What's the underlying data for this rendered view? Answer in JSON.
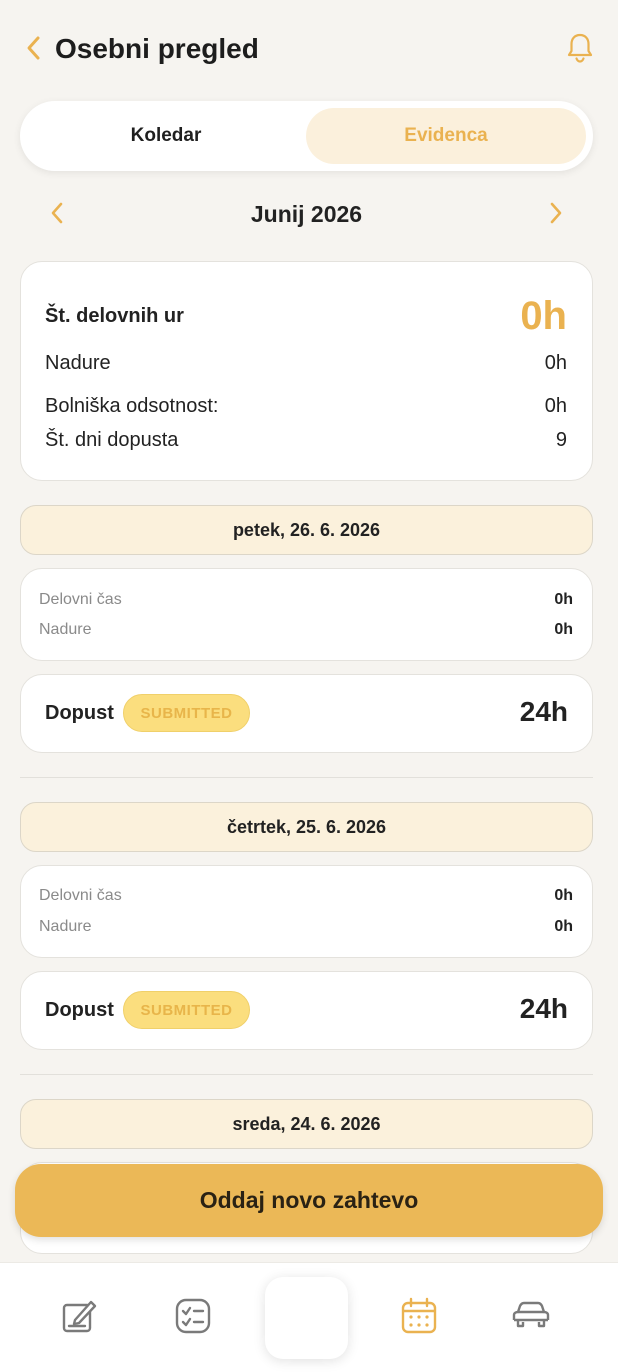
{
  "header": {
    "title": "Osebni pregled",
    "back_icon": "chevron-left-icon",
    "bell_icon": "bell-icon"
  },
  "segmented": {
    "tabs": [
      {
        "label": "Koledar",
        "active": false
      },
      {
        "label": "Evidenca",
        "active": true
      }
    ]
  },
  "month_nav": {
    "label": "Junij 2026"
  },
  "summary": {
    "work_hours_label": "Št. delovnih ur",
    "work_hours_value": "0h",
    "overtime_label": "Nadure",
    "overtime_value": "0h",
    "sick_label": "Bolniška odsotnost:",
    "sick_value": "0h",
    "vacation_days_label": "Št. dni dopusta",
    "vacation_days_value": "9"
  },
  "days": [
    {
      "date": "petek, 26. 6. 2026",
      "work_time_label": "Delovni čas",
      "work_time_value": "0h",
      "overtime_label": "Nadure",
      "overtime_value": "0h",
      "leave": {
        "type": "Dopust",
        "status": "SUBMITTED",
        "hours": "24h"
      }
    },
    {
      "date": "četrtek, 25. 6. 2026",
      "work_time_label": "Delovni čas",
      "work_time_value": "0h",
      "overtime_label": "Nadure",
      "overtime_value": "0h",
      "leave": {
        "type": "Dopust",
        "status": "SUBMITTED",
        "hours": "24h"
      }
    },
    {
      "date": "sreda, 24. 6. 2026"
    }
  ],
  "cta": {
    "label": "Oddaj novo zahtevo"
  },
  "tabbar": {
    "items": [
      {
        "icon": "edit-icon",
        "active": false
      },
      {
        "icon": "checklist-icon",
        "active": false
      },
      {
        "icon": "center-action",
        "active": false
      },
      {
        "icon": "calendar-icon",
        "active": true
      },
      {
        "icon": "car-icon",
        "active": false
      }
    ]
  },
  "colors": {
    "accent": "#eab250",
    "cta": "#ebb857",
    "badge_bg": "#fbde7e",
    "day_header_bg": "#fbf1dc",
    "background": "#f6f4f0"
  }
}
